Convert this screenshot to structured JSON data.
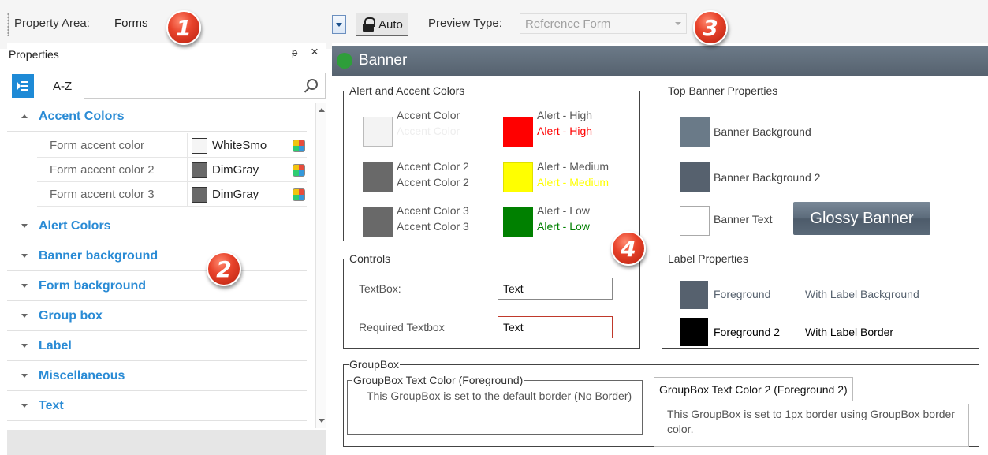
{
  "toolbar": {
    "property_area_label": "Property Area:",
    "property_area_value": "Forms",
    "auto_label": "Auto",
    "preview_type_label": "Preview Type:",
    "preview_type_value": "Reference Form"
  },
  "callouts": [
    "1",
    "2",
    "3",
    "4"
  ],
  "properties_panel": {
    "title": "Properties",
    "pin_glyph": "ᵽ",
    "close_glyph": "×",
    "sort_az_label": "A-Z",
    "search_placeholder": "",
    "categories": [
      {
        "label": "Accent Colors",
        "expanded": true
      },
      {
        "label": "Alert Colors",
        "expanded": false
      },
      {
        "label": "Banner background",
        "expanded": false
      },
      {
        "label": "Form background",
        "expanded": false
      },
      {
        "label": "Group box",
        "expanded": false
      },
      {
        "label": "Label",
        "expanded": false
      },
      {
        "label": "Miscellaneous",
        "expanded": false
      },
      {
        "label": "Text",
        "expanded": false
      }
    ],
    "accent_properties": [
      {
        "name": "Form accent color",
        "value": "WhiteSmo",
        "color": "#f5f5f5"
      },
      {
        "name": "Form accent color 2",
        "value": "DimGray",
        "color": "#696969"
      },
      {
        "name": "Form accent color 3",
        "value": "DimGray",
        "color": "#696969"
      }
    ]
  },
  "preview": {
    "banner_title": "Banner",
    "alert_accent": {
      "legend": "Alert and Accent Colors",
      "accent": [
        {
          "label": "Accent Color",
          "sample": "Accent Color",
          "swatch": "#f3f3f3",
          "sample_color": "#f0f0f0"
        },
        {
          "label": "Accent Color 2",
          "sample": "Accent Color 2",
          "swatch": "#696969",
          "sample_color": "#555555"
        },
        {
          "label": "Accent Color 3",
          "sample": "Accent Color 3",
          "swatch": "#696969",
          "sample_color": "#555555"
        }
      ],
      "alerts": [
        {
          "label": "Alert - High",
          "sample": "Alert - High",
          "swatch": "#ff0000",
          "sample_color": "#ff0000"
        },
        {
          "label": "Alert - Medium",
          "sample": "Alert - Medium",
          "swatch": "#ffff00",
          "sample_color": "#ffff00"
        },
        {
          "label": "Alert - Low",
          "sample": "Alert - Low",
          "swatch": "#008000",
          "sample_color": "#008000"
        }
      ]
    },
    "top_banner": {
      "legend": "Top Banner Properties",
      "items": [
        {
          "label": "Banner Background",
          "swatch": "#6a7a88"
        },
        {
          "label": "Banner Background 2",
          "swatch": "#56616e"
        },
        {
          "label": "Banner Text",
          "swatch": "#ffffff"
        }
      ],
      "glossy_label": "Glossy Banner"
    },
    "controls": {
      "legend": "Controls",
      "textbox_label": "TextBox:",
      "textbox_value": "Text",
      "required_label": "Required Textbox",
      "required_value": "Text",
      "required_border": "#c0392b"
    },
    "label_props": {
      "legend": "Label Properties",
      "foreground": "Foreground",
      "foreground_swatch": "#56616e",
      "with_bg": "With Label Background",
      "foreground2": "Foreground 2",
      "foreground2_swatch": "#000000",
      "with_border": "With Label Border"
    },
    "groupbox": {
      "legend": "GroupBox",
      "inner_legend": "GroupBox Text Color (Foreground)",
      "inner_text": "This GroupBox is set to the default border (No Border)",
      "tab_label": "GroupBox Text Color 2 (Foreground 2)",
      "tab_text": "This GroupBox is set to 1px border using GroupBox border color."
    }
  }
}
